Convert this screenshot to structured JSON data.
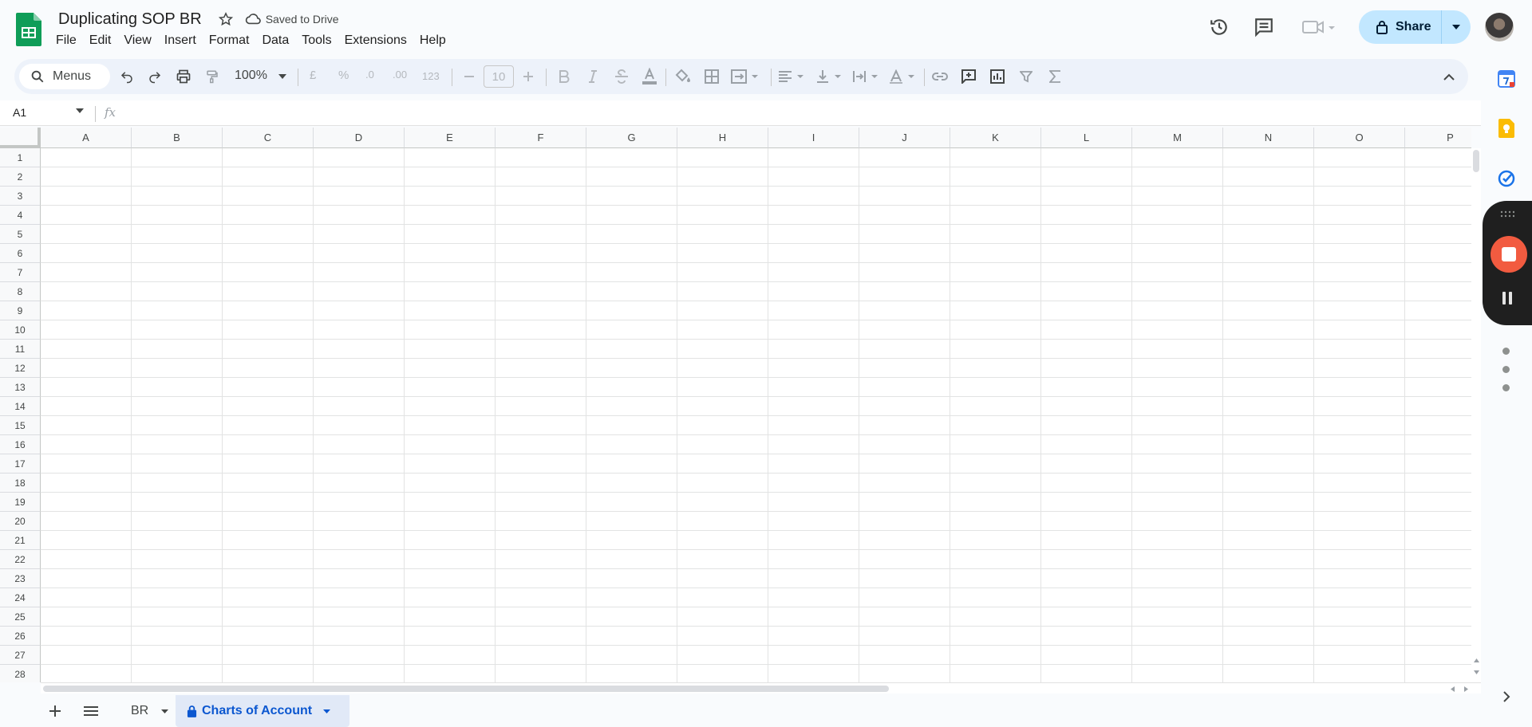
{
  "app": {
    "title": "Duplicating SOP BR",
    "save_status": "Saved to Drive",
    "share_label": "Share"
  },
  "menu": [
    "File",
    "Edit",
    "View",
    "Insert",
    "Format",
    "Data",
    "Tools",
    "Extensions",
    "Help"
  ],
  "toolbar": {
    "search_label": "Menus",
    "zoom": "100%",
    "currency": "£",
    "percent": "%",
    "decrease_decimal": ".0",
    "increase_decimal": ".00",
    "number_format": "123",
    "font_size": "10"
  },
  "formula_bar": {
    "cell_ref": "A1",
    "fx_label": "fx"
  },
  "grid": {
    "columns": [
      "A",
      "B",
      "C",
      "D",
      "E",
      "F",
      "G",
      "H",
      "I",
      "J",
      "K",
      "L",
      "M",
      "N",
      "O",
      "P"
    ],
    "rows": [
      "1",
      "2",
      "3",
      "4",
      "5",
      "6",
      "7",
      "8",
      "9",
      "10",
      "11",
      "12",
      "13",
      "14",
      "15",
      "16",
      "17",
      "18",
      "19",
      "20",
      "21",
      "22",
      "23",
      "24",
      "25",
      "26",
      "27",
      "28"
    ]
  },
  "sheets": {
    "tabs": [
      {
        "label": "BR",
        "active": false
      },
      {
        "label": "Charts of Account",
        "active": true,
        "locked": true
      }
    ]
  },
  "colors": {
    "accent": "#0b57d0",
    "share_bg": "#c2e7ff",
    "toolbar_bg": "#edf2fa",
    "record_stop": "#f25b40"
  }
}
